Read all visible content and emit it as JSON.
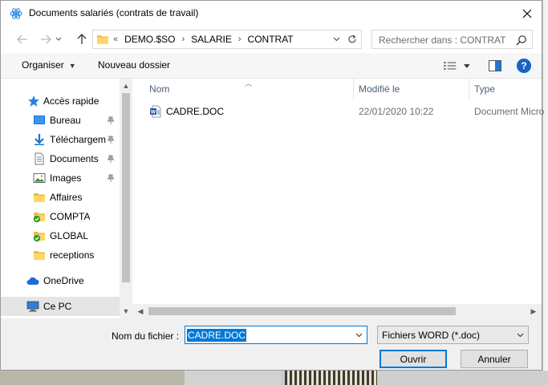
{
  "window": {
    "title": "Documents salariés (contrats de travail)",
    "close_icon": "close-icon"
  },
  "nav": {
    "back_icon": "back-arrow-icon",
    "forward_icon": "forward-arrow-icon",
    "up_icon": "up-arrow-icon",
    "address_prefix": "«",
    "breadcrumb": [
      "DEMO.$SO",
      "SALARIE",
      "CONTRAT"
    ],
    "search_placeholder": "Rechercher dans : CONTRAT"
  },
  "commandbar": {
    "organize_label": "Organiser",
    "new_folder_label": "Nouveau dossier"
  },
  "sidebar": {
    "items": [
      {
        "label": "Accès rapide",
        "icon": "star-icon",
        "pinned": false
      },
      {
        "label": "Bureau",
        "icon": "desktop-icon",
        "pinned": true
      },
      {
        "label": "Téléchargements",
        "icon": "download-icon",
        "pinned": true
      },
      {
        "label": "Documents",
        "icon": "documents-icon",
        "pinned": true
      },
      {
        "label": "Images",
        "icon": "images-icon",
        "pinned": true
      },
      {
        "label": "Affaires",
        "icon": "folder-icon",
        "pinned": false
      },
      {
        "label": "COMPTA",
        "icon": "synced-folder-icon",
        "pinned": false
      },
      {
        "label": "GLOBAL",
        "icon": "synced-folder-icon",
        "pinned": false
      },
      {
        "label": "receptions",
        "icon": "folder-icon",
        "pinned": false
      },
      {
        "label": "OneDrive",
        "icon": "cloud-icon",
        "pinned": false
      },
      {
        "label": "Ce PC",
        "icon": "computer-icon",
        "pinned": false
      }
    ]
  },
  "filelist": {
    "columns": [
      "Nom",
      "Modifié le",
      "Type"
    ],
    "rows": [
      {
        "name": "CADRE.DOC",
        "modified": "22/01/2020 10:22",
        "type": "Document Micro",
        "icon": "word-document-icon"
      }
    ]
  },
  "footer": {
    "filename_label": "Nom du fichier :",
    "filename_value": "CADRE.DOC",
    "filter_value": "Fichiers WORD (*.doc)",
    "open_label": "Ouvrir",
    "cancel_label": "Annuler"
  },
  "colors": {
    "accent": "#0078d7",
    "help": "#1764c0",
    "header_text": "#4c607a"
  }
}
